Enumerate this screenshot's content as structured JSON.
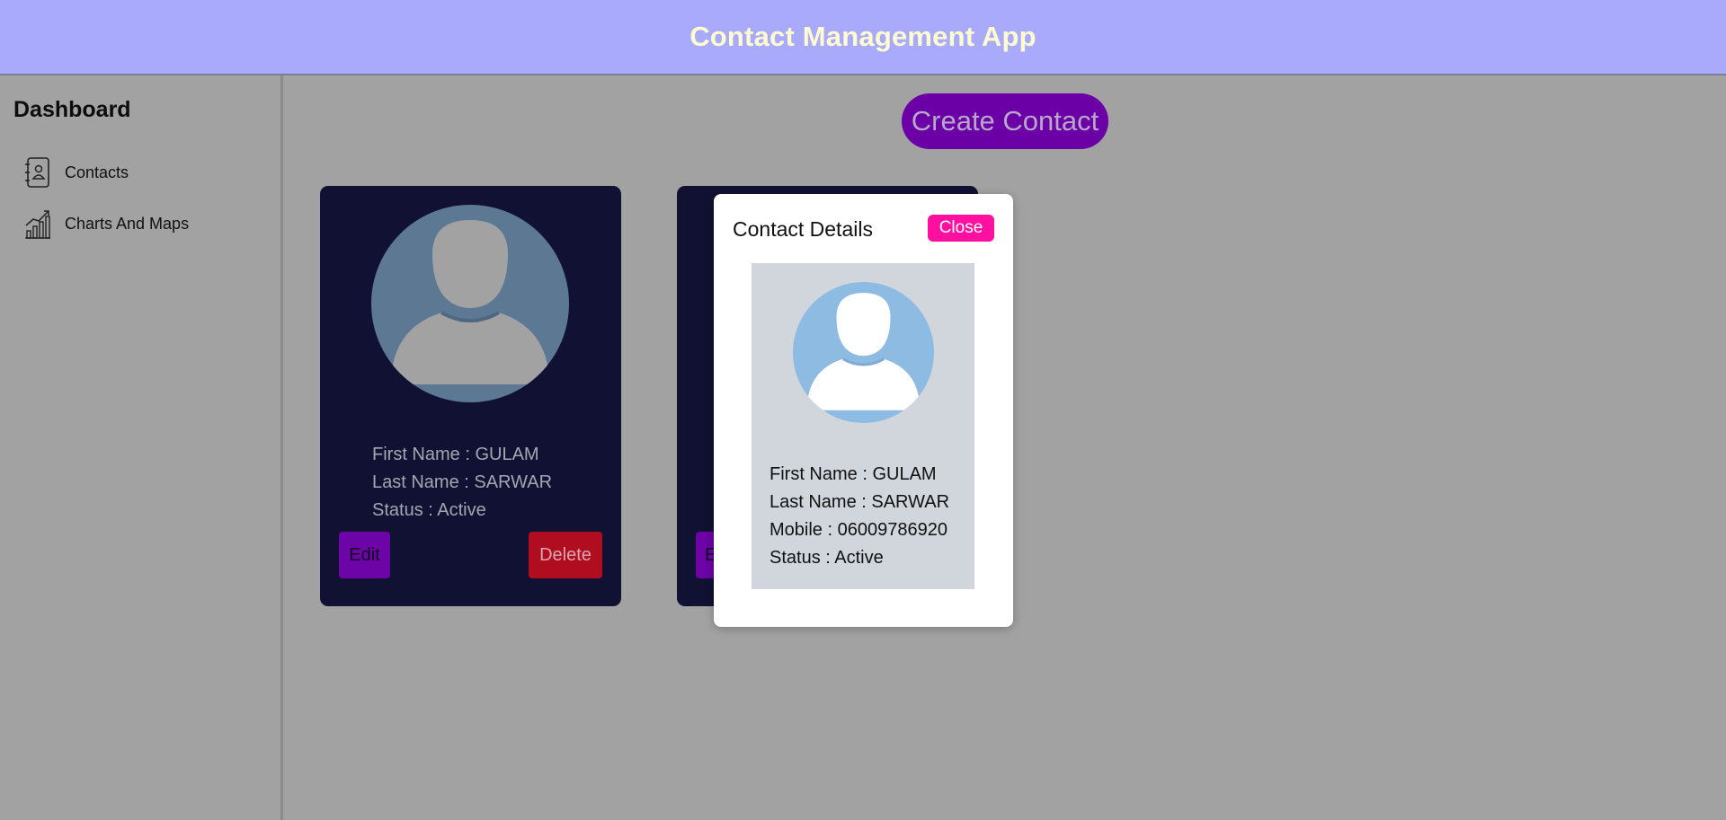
{
  "header": {
    "title": "Contact Management App"
  },
  "sidebar": {
    "heading": "Dashboard",
    "items": [
      {
        "label": "Contacts",
        "icon": "contacts-book-icon"
      },
      {
        "label": "Charts And Maps",
        "icon": "chart-icon"
      }
    ]
  },
  "main": {
    "create_button": "Create Contact",
    "cards": [
      {
        "first_name": "First Name : GULAM",
        "last_name": "Last Name : SARWAR",
        "status": "Status : Active",
        "edit_label": "Edit",
        "delete_label": "Delete"
      },
      {
        "edit_label": "E"
      }
    ]
  },
  "modal": {
    "title": "Contact Details",
    "close_label": "Close",
    "first_name": "First Name : GULAM",
    "last_name": "Last Name : SARWAR",
    "mobile": "Mobile : 06009786920",
    "status": "Status : Active"
  },
  "colors": {
    "header_bg": "#a9aafb",
    "header_text": "#fdfbd0",
    "overlay_bg": "#a2a2a2",
    "primary_purple": "#6a00a6",
    "card_bg": "#111133",
    "delete_red": "#b00d20",
    "close_pink": "#ff10a0"
  }
}
